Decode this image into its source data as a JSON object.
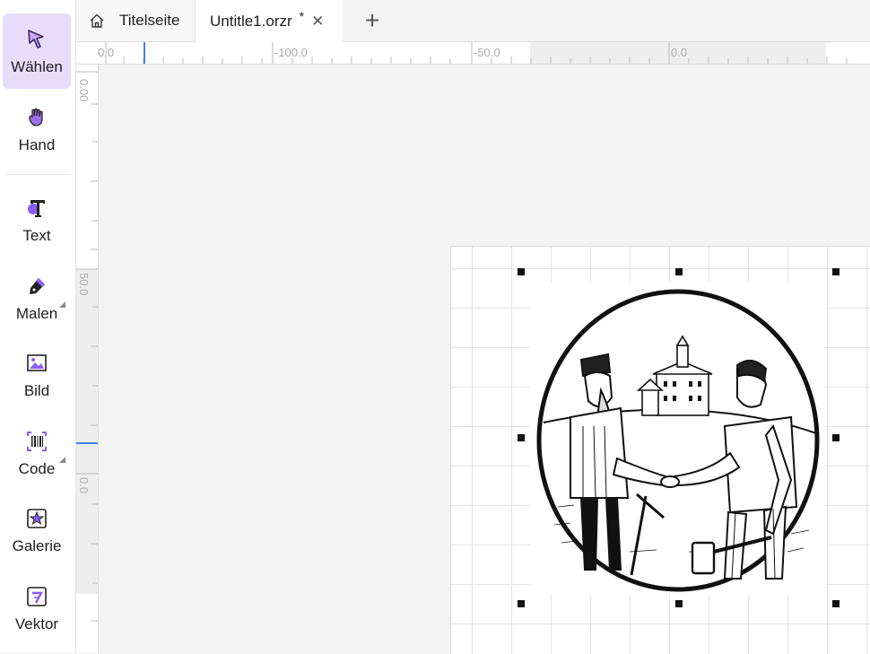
{
  "toolbar": {
    "tools": [
      {
        "id": "select",
        "label": "Wählen",
        "icon": "select-cursor-icon",
        "active": true
      },
      {
        "id": "hand",
        "label": "Hand",
        "icon": "hand-icon"
      },
      {
        "id": "text",
        "label": "Text",
        "icon": "text-icon"
      },
      {
        "id": "paint",
        "label": "Malen",
        "icon": "pen-icon",
        "has_submenu": true
      },
      {
        "id": "image",
        "label": "Bild",
        "icon": "image-icon"
      },
      {
        "id": "code",
        "label": "Code",
        "icon": "barcode-icon",
        "has_submenu": true
      },
      {
        "id": "gallery",
        "label": "Galerie",
        "icon": "gallery-star-icon"
      },
      {
        "id": "vector",
        "label": "Vektor",
        "icon": "vector-icon"
      }
    ]
  },
  "tabs": {
    "home_label": "Titelseite",
    "doc_label": "Untitle1.orzr",
    "doc_modified_mark": "*",
    "close_symbol": "✕",
    "add_symbol": "+"
  },
  "ruler_top": {
    "labels": [
      "0.0",
      "-100.0",
      "-50.0",
      "0.0"
    ]
  },
  "ruler_left": {
    "labels": [
      "0.00",
      "50.0",
      "0.0"
    ]
  },
  "colors": {
    "accent": "#7b4fd6",
    "active_bg": "#e8dcfb",
    "ruler_marker": "#3b82f6"
  }
}
